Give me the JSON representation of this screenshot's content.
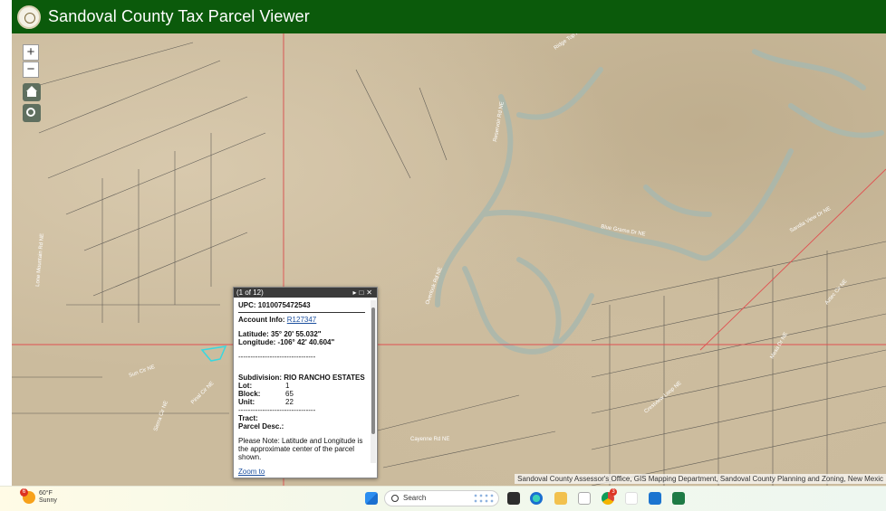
{
  "app": {
    "title": "Sandoval County Tax Parcel Viewer"
  },
  "map": {
    "zoom_in_label": "+",
    "zoom_out_label": "−",
    "attribution": "Sandoval County Assessor's Office, GIS Mapping Department, Sandoval County Planning and Zoning, New Mexic",
    "street_labels": [
      "Ridge Top Rd",
      "Reservoir Rd NE",
      "Blue Grama Dr NE",
      "Overlook Rd NE",
      "Cayenne Rd NE",
      "Pinal Cir NE",
      "Sierra Cir NE",
      "Sun Cir NE",
      "Mesa Dr NE",
      "Aztec Cir NE",
      "Crestview Loop NE",
      "Sandia View Dr NE",
      "Lone Mountain Rd NE"
    ]
  },
  "popup": {
    "counter": "(1 of 12)",
    "upc": "UPC: 1010075472543",
    "account_label": "Account Info:",
    "account_link": "R127347",
    "latitude": "Latitude: 35° 20' 55.032\"",
    "longitude": "Longitude: -106° 42' 40.604\"",
    "dashes": "--------------------------------",
    "subdivision": "Subdivision: RIO RANCHO ESTATES",
    "lot_label": "Lot:",
    "lot_value": "1",
    "block_label": "Block:",
    "block_value": "65",
    "unit_label": "Unit:",
    "unit_value": "22",
    "tract_label": "Tract:",
    "parcel_label": "Parcel Desc.:",
    "note": "Please Note: Latitude and Longitude is the approximate center of the parcel shown.",
    "zoom_link": "Zoom to"
  },
  "taskbar": {
    "weather_badge": "6",
    "temperature": "60°F",
    "condition": "Sunny",
    "search_placeholder": "Search",
    "app_badge": "3"
  }
}
